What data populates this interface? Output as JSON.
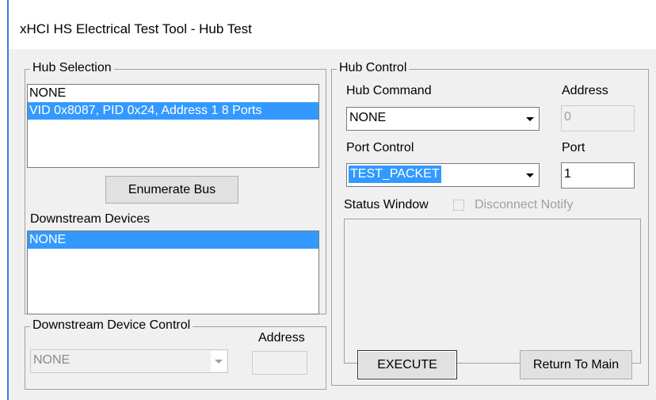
{
  "window": {
    "title": "xHCI HS Electrical Test Tool - Hub Test"
  },
  "hub_selection": {
    "legend": "Hub Selection",
    "items": [
      "NONE",
      "VID 0x8087, PID 0x24, Address 1  8 Ports"
    ],
    "selected_index": 1,
    "enumerate_label": "Enumerate Bus",
    "downstream_label": "Downstream Devices",
    "downstream_items": [
      "NONE"
    ]
  },
  "downstream_control": {
    "legend": "Downstream Device Control",
    "address_label": "Address",
    "combo_value": "NONE",
    "address_value": ""
  },
  "hub_control": {
    "legend": "Hub Control",
    "hub_command_label": "Hub Command",
    "hub_command_value": "NONE",
    "address_label": "Address",
    "address_value": "0",
    "port_control_label": "Port Control",
    "port_control_value": "TEST_PACKET",
    "port_label": "Port",
    "port_value": "1",
    "status_label": "Status Window",
    "disconnect_label": "Disconnect Notify",
    "disconnect_checked": false,
    "execute_label": "EXECUTE",
    "return_label": "Return To Main"
  }
}
